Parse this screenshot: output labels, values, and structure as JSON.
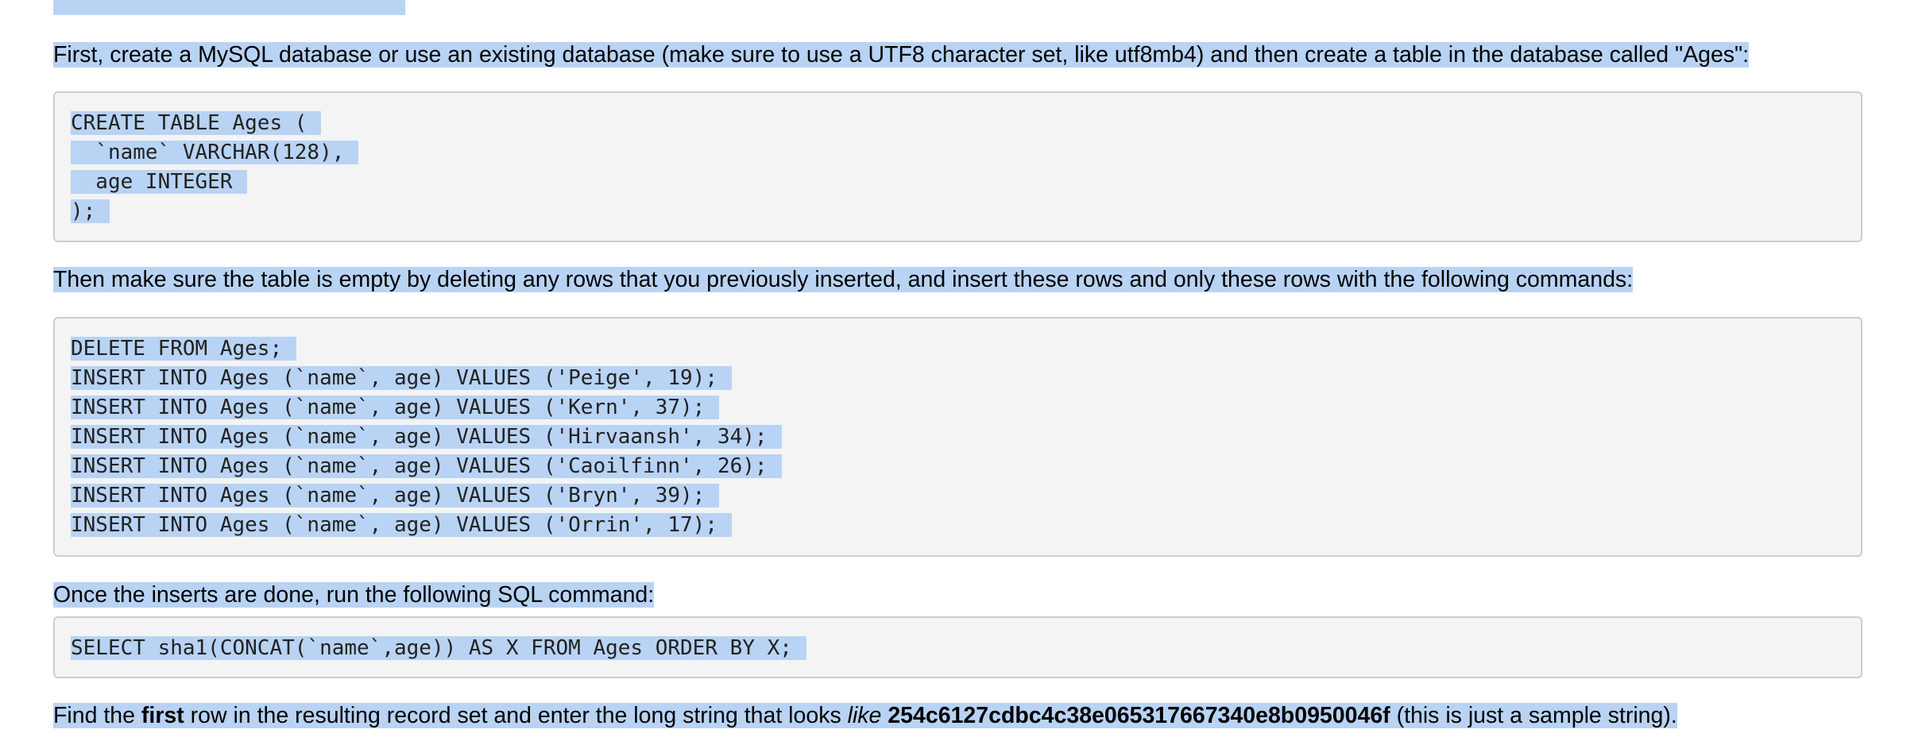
{
  "paragraphs": {
    "p1": "First, create a MySQL database or use an existing database (make sure to use a UTF8 character set, like utf8mb4) and then create a table in the database called \"Ages\":",
    "p2": "Then make sure the table is empty by deleting any rows that you previously inserted, and insert these rows and only these rows with the following commands:",
    "p3": "Once the inserts are done, run the following SQL command:",
    "p4": {
      "pre": "Find the ",
      "bold1": "first",
      "mid": " row in the resulting record set and enter the long string that looks ",
      "italic": "like",
      "space": " ",
      "bold2": "254c6127cdbc4c38e065317667340e8b0950046f",
      "post": " (this is just a sample string)."
    }
  },
  "code_create": [
    "CREATE TABLE Ages (",
    "  `name` VARCHAR(128),",
    "  age INTEGER",
    ");"
  ],
  "code_insert": [
    "DELETE FROM Ages;",
    "INSERT INTO Ages (`name`, age) VALUES ('Peige', 19);",
    "INSERT INTO Ages (`name`, age) VALUES ('Kern', 37);",
    "INSERT INTO Ages (`name`, age) VALUES ('Hirvaansh', 34);",
    "INSERT INTO Ages (`name`, age) VALUES ('Caoilfinn', 26);",
    "INSERT INTO Ages (`name`, age) VALUES ('Bryn', 39);",
    "INSERT INTO Ages (`name`, age) VALUES ('Orrin', 17);"
  ],
  "code_select": [
    "SELECT sha1(CONCAT(`name`,age)) AS X FROM Ages ORDER BY X;"
  ],
  "colors": {
    "selection": "#b8d3f4",
    "code_background": "#f4f4f4",
    "code_border": "#cdcdcd"
  }
}
